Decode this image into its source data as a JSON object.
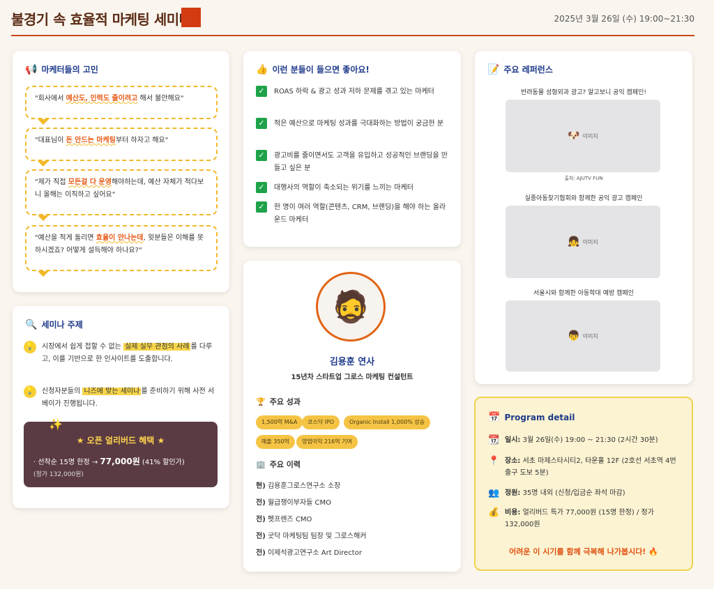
{
  "header": {
    "title": "불경기 속 효율적 마케팅 세미나",
    "date": "2025년 3월 26일 (수) 19:00~21:30"
  },
  "concerns": {
    "title": "마케터들의 고민",
    "icon": "megaphone-icon",
    "items": [
      {
        "pre": "\"회사에서 ",
        "hl": "예산도, 인력도 줄이려고",
        "post": " 해서 불안해요\""
      },
      {
        "pre": "\"대표님이 ",
        "hl": "돈 안드는 마케팅",
        "post": "부터 하자고 해요\""
      },
      {
        "pre": "\"제가 직접 ",
        "hl": "모든걸 다 운영",
        "post": "해야하는데, 예산 자체가 적다보니 올해는 이직하고 싶어요\""
      },
      {
        "pre": "\"예산을 적게 돌리면 ",
        "hl": "효율이 안나는데",
        "post": ", 윗분들은 이해를 못하시겠죠? 어떻게 설득해야 하나요?\""
      }
    ]
  },
  "topic": {
    "title": "세미나 주제",
    "icon": "magnifier-icon",
    "items": [
      {
        "pre": "시장에서 쉽게 접할 수 없는 ",
        "hl": "실제 실무 관점의 사례",
        "post": "를 다루고, 이를 기반으로 한 인사이트를 도출합니다."
      },
      {
        "pre": "신청자분들의 ",
        "hl": "니즈에 맞는 세미나",
        "post": "를 준비하기 위해 사전 서베이가 진행됩니다."
      }
    ],
    "benefit_title": "★ 오픈 얼리버드 혜택 ★",
    "benefit_line_pre": "· 선착순 15명 한정 → ",
    "benefit_price": "77,000원",
    "benefit_line_post": " (41% 할인가)",
    "benefit_sub": "(정가 132,000원)"
  },
  "audience": {
    "title": "이런 분들이 들으면 좋아요!",
    "icon": "thumbs-up-icon",
    "items": [
      "ROAS 하락 & 광고 성과 저하 문제를 겪고 있는 마케터",
      "적은 예산으로 마케팅 성과를 극대화하는 방법이 궁금한 분",
      "광고비를 줄이면서도 고객을 유입하고 성공적인 브랜딩을 만들고 싶은 분",
      "대행사의 역할이 축소되는 위기를 느끼는 마케터",
      "한 명이 여러 역할(콘텐츠, CRM, 브랜딩)을 해야 하는 올라운드 마케터"
    ]
  },
  "speaker": {
    "name": "김용훈 연사",
    "role": "15년차 스타트업 그로스 마케팅 컨설턴트",
    "achievements_title": "주요 성과",
    "achievements": [
      "1,500억 M&A",
      "코스닥 IPO",
      "Organic Install 1,000% 상승",
      "매출 350억",
      "영업이익 216억 기여"
    ],
    "career_title": "주요 이력",
    "career": [
      {
        "k": "현)",
        "v": " 김용훈그로스연구소 소장"
      },
      {
        "k": "전)",
        "v": " 월급쟁이부자들 CMO"
      },
      {
        "k": "전)",
        "v": " 펫프렌즈 CMO"
      },
      {
        "k": "전)",
        "v": " 굿닥 마케팅팀 팀장 및 그로스해커"
      },
      {
        "k": "전)",
        "v": " 이제석광고연구소 Art Director"
      }
    ]
  },
  "references": {
    "title": "주요 레퍼런스",
    "icon": "memo-icon",
    "items": [
      {
        "caption": "반려동물 성형외과 광고? 알고보니 공익 캠페인!",
        "image_label": "이미지",
        "icon": "dog-icon",
        "source": "출처: AJUTV FUN"
      },
      {
        "caption": "실종아동찾기협회와 함께한 공익 광고 캠페인",
        "image_label": "이미지",
        "icon": "child-icon",
        "source": ""
      },
      {
        "caption": "서울시와 함께한 아동학대 예방 캠페인",
        "image_label": "이미지",
        "icon": "kid-icon",
        "source": ""
      }
    ]
  },
  "program": {
    "title": "Program detail",
    "items": [
      {
        "icon": "calendar-icon",
        "label": "일시:",
        "value": " 3월 26일(수) 19:00 ~ 21:30 (2시간 30분)"
      },
      {
        "icon": "pin-icon",
        "label": "장소:",
        "value": " 서초 마제스타시티2, 타운홀 12F (2호선 서초역 4번 출구 도보 5분)"
      },
      {
        "icon": "people-icon",
        "label": "정원:",
        "value": " 35명 내외 (신청/입금순 좌석 마감)"
      },
      {
        "icon": "money-bag-icon",
        "label": "비용:",
        "value": " 얼리버드 특가 77,000원 (15명 한정) / 정가 132,000원"
      }
    ],
    "footer": "어려운 이 시기를 함께 극복해 나가봅시다! 🔥"
  }
}
